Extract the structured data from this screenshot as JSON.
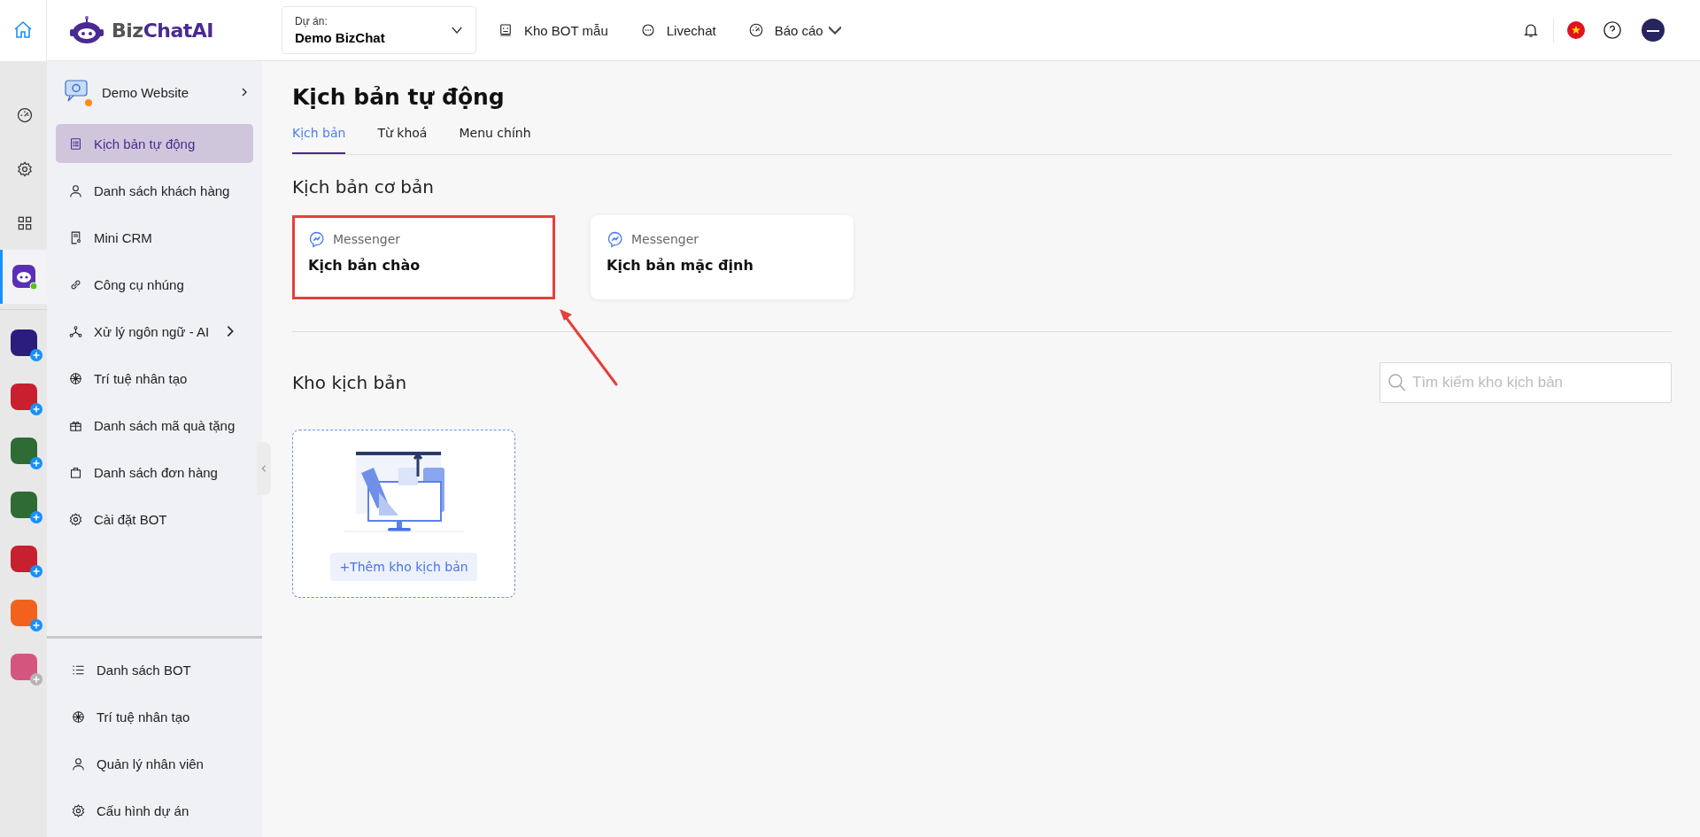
{
  "topbar": {
    "logo": {
      "text_1": "Biz",
      "text_2": "ChatAI"
    },
    "project": {
      "label": "Dự án:",
      "value": "Demo BizChat"
    },
    "nav": [
      {
        "label": "Kho BOT mẫu",
        "kind": "bot",
        "dropdown": false
      },
      {
        "label": "Livechat",
        "kind": "chat",
        "dropdown": false
      },
      {
        "label": "Báo cáo",
        "kind": "gauge",
        "dropdown": true
      }
    ]
  },
  "rail": {
    "items": [
      {
        "kind": "gauge",
        "selected": false
      },
      {
        "kind": "gear",
        "selected": false
      },
      {
        "kind": "grid",
        "selected": false
      },
      {
        "kind": "bot",
        "selected": true
      }
    ],
    "apps": [
      {
        "color": "#2b1d7e",
        "badge_disabled": false
      },
      {
        "color": "#c8202e",
        "badge_disabled": false
      },
      {
        "color": "#2e6b35",
        "badge_disabled": false
      },
      {
        "color": "#2e6b35",
        "badge_disabled": false
      },
      {
        "color": "#c8202e",
        "badge_disabled": false
      },
      {
        "color": "#f2621c",
        "badge_disabled": false
      },
      {
        "color": "#d4567e",
        "badge_disabled": true
      }
    ]
  },
  "sidebar": {
    "header": {
      "title": "Demo Website"
    },
    "items": [
      {
        "label": "Kịch bản tự động",
        "kind": "list",
        "selected": true,
        "submenu": false
      },
      {
        "label": "Danh sách khách hàng",
        "kind": "user",
        "selected": false,
        "submenu": false
      },
      {
        "label": "Mini CRM",
        "kind": "doc",
        "selected": false,
        "submenu": false
      },
      {
        "label": "Công cụ nhúng",
        "kind": "link",
        "selected": false,
        "submenu": false
      },
      {
        "label": "Xử lý ngôn ngữ - AI",
        "kind": "nodes",
        "selected": false,
        "submenu": true
      },
      {
        "label": "Trí tuệ nhân tạo",
        "kind": "ai",
        "selected": false,
        "submenu": false
      },
      {
        "label": "Danh sách mã quà tặng",
        "kind": "gift",
        "selected": false,
        "submenu": false
      },
      {
        "label": "Danh sách đơn hàng",
        "kind": "bag",
        "selected": false,
        "submenu": false
      },
      {
        "label": "Cài đặt BOT",
        "kind": "gear",
        "selected": false,
        "submenu": false
      }
    ],
    "bottom_items": [
      {
        "label": "Danh sách BOT",
        "kind": "lines",
        "selected": false,
        "submenu": false
      },
      {
        "label": "Trí tuệ nhân tạo",
        "kind": "ai",
        "selected": false,
        "submenu": false
      },
      {
        "label": "Quản lý nhân viên",
        "kind": "user",
        "selected": false,
        "submenu": false
      },
      {
        "label": "Cấu hình dự án",
        "kind": "gear",
        "selected": false,
        "submenu": false
      }
    ]
  },
  "main": {
    "title": "Kịch bản tự động",
    "tabs": [
      {
        "label": "Kịch bản",
        "selected": true
      },
      {
        "label": "Từ khoá",
        "selected": false
      },
      {
        "label": "Menu chính",
        "selected": false
      }
    ],
    "basic": {
      "title": "Kịch bản cơ bản",
      "cards": [
        {
          "channel": "Messenger",
          "title": "Kịch bản chào",
          "highlighted": true
        },
        {
          "channel": "Messenger",
          "title": "Kịch bản mặc định",
          "highlighted": false
        }
      ]
    },
    "library": {
      "title": "Kho kịch bản",
      "search": {
        "placeholder": "Tìm kiếm kho kịch bản"
      },
      "add_button": "+Thêm kho kịch bản"
    }
  }
}
